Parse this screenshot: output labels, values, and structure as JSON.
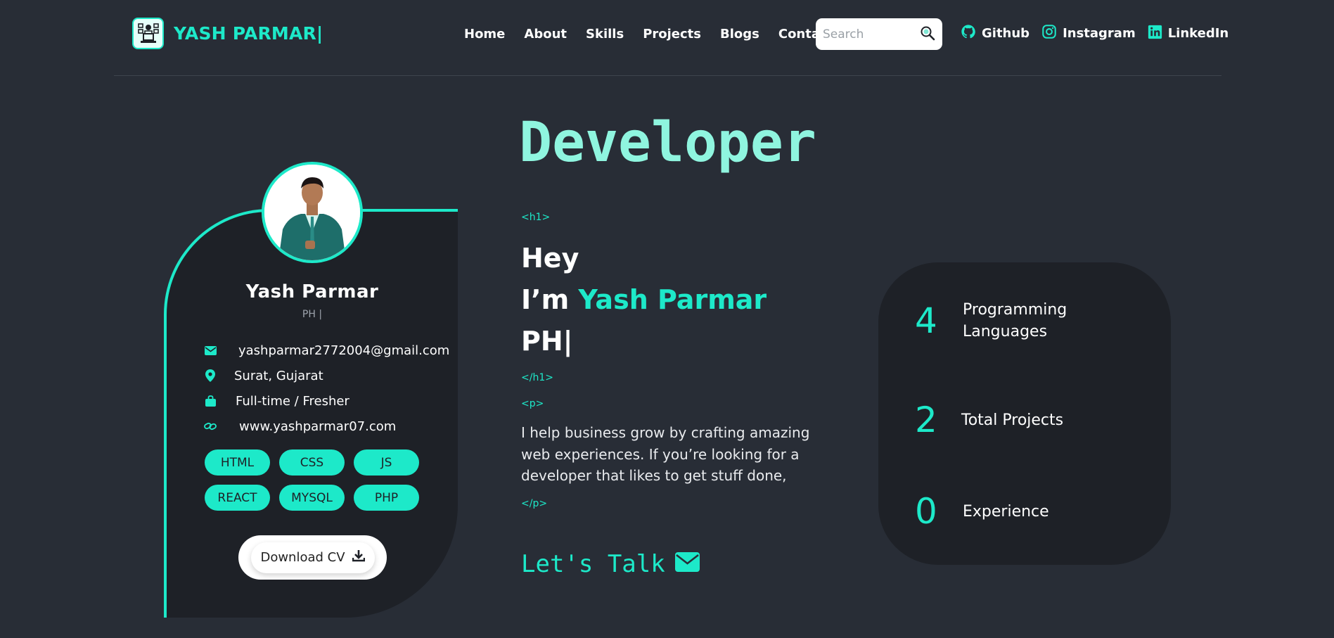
{
  "brand": {
    "name": "YASH PARMAR|"
  },
  "nav": {
    "links": [
      "Home",
      "About",
      "Skills",
      "Projects",
      "Blogs",
      "Contact"
    ],
    "search_placeholder": "Search"
  },
  "socials": [
    {
      "label": "Github",
      "icon": "github-icon"
    },
    {
      "label": "Instagram",
      "icon": "instagram-icon"
    },
    {
      "label": "LinkedIn",
      "icon": "linkedin-icon"
    }
  ],
  "hero": {
    "title": "Developer"
  },
  "profile": {
    "name": "Yash Parmar",
    "role": "PH |",
    "info": [
      {
        "icon": "mail-icon",
        "text": "yashparmar2772004@gmail.com"
      },
      {
        "icon": "location-icon",
        "text": "Surat, Gujarat"
      },
      {
        "icon": "briefcase-icon",
        "text": "Full-time / Fresher"
      },
      {
        "icon": "link-icon",
        "text": "www.yashparmar07.com"
      }
    ],
    "skills": [
      "HTML",
      "CSS",
      "JS",
      "REACT",
      "MYSQL",
      "PHP"
    ],
    "download_label": "Download CV"
  },
  "intro": {
    "tag_h1_open": "<h1>",
    "line1": "Hey",
    "line2_prefix": "I’m ",
    "line2_name": "Yash Parmar",
    "line3": "PH|",
    "tag_h1_close": "</h1>",
    "tag_p_open": "<p>",
    "description": "I help business grow by crafting amazing web experiences. If you’re looking for a developer that likes to get stuff done,",
    "tag_p_close": "</p>",
    "cta": "Let's Talk"
  },
  "stats": [
    {
      "value": "4",
      "label_line1": "Programming",
      "label_line2": "Languages"
    },
    {
      "value": "2",
      "label_line1": "Total Projects",
      "label_line2": ""
    },
    {
      "value": "0",
      "label_line1": "Experience",
      "label_line2": ""
    }
  ],
  "colors": {
    "accent": "#1de9c9",
    "background": "#282d36",
    "card": "#1e2127",
    "title": "#8ff5df"
  }
}
